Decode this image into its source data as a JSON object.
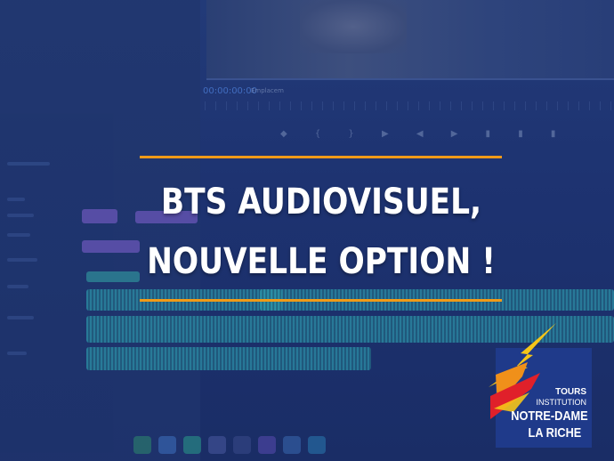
{
  "background": {
    "timecode": "00:00:00:00",
    "zoom_label": "Emplacem"
  },
  "headline": {
    "line1": "BTS AUDIOVISUEL,",
    "line2": "NOUVELLE OPTION !",
    "rule_color": "#f09a18",
    "text_color": "#ffffff"
  },
  "logo": {
    "city": "TOURS",
    "institution": "INSTITUTION",
    "name": "NOTRE-DAME",
    "place": "LA RICHE",
    "colors": {
      "panel": "#1f3a8a",
      "yellow": "#f5c518",
      "red": "#e0202a",
      "orange": "#f0901a"
    }
  }
}
